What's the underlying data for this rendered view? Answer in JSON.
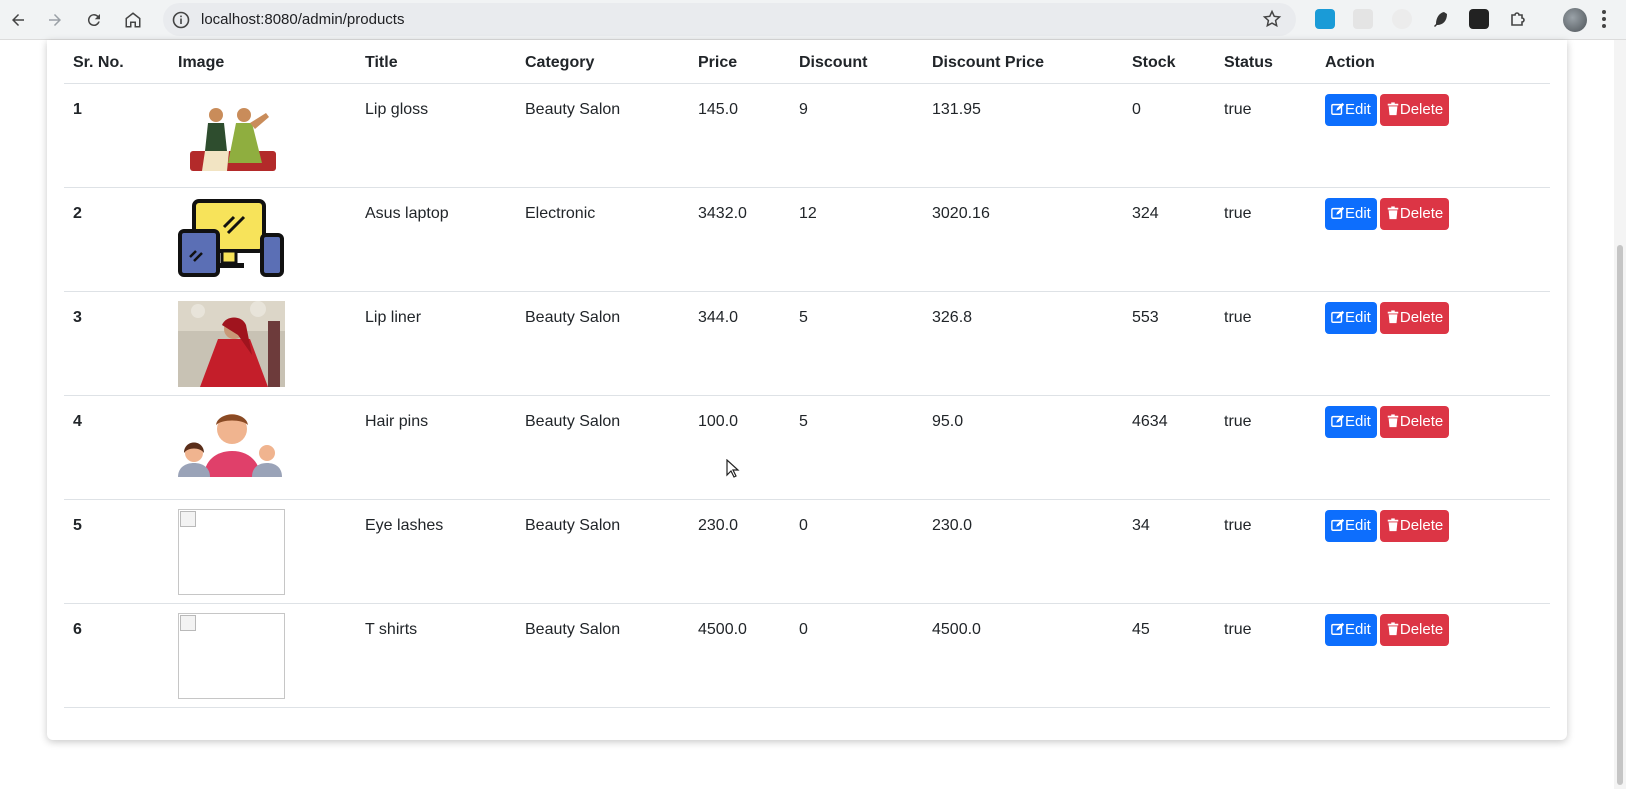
{
  "browser": {
    "url": "localhost:8080/admin/products"
  },
  "table": {
    "headers": [
      "Sr. No.",
      "Image",
      "Title",
      "Category",
      "Price",
      "Discount",
      "Discount Price",
      "Stock",
      "Status",
      "Action"
    ],
    "rows": [
      {
        "sr": "1",
        "image": "couple-illustration",
        "title": "Lip gloss",
        "category": "Beauty Salon",
        "price": "145.0",
        "discount": "9",
        "discount_price": "131.95",
        "stock": "0",
        "status": "true"
      },
      {
        "sr": "2",
        "image": "devices-icon",
        "title": "Asus laptop",
        "category": "Electronic",
        "price": "3432.0",
        "discount": "12",
        "discount_price": "3020.16",
        "stock": "324",
        "status": "true"
      },
      {
        "sr": "3",
        "image": "bride-photo",
        "title": "Lip liner",
        "category": "Beauty Salon",
        "price": "344.0",
        "discount": "5",
        "discount_price": "326.8",
        "stock": "553",
        "status": "true"
      },
      {
        "sr": "4",
        "image": "family-illustration",
        "title": "Hair pins",
        "category": "Beauty Salon",
        "price": "100.0",
        "discount": "5",
        "discount_price": "95.0",
        "stock": "4634",
        "status": "true"
      },
      {
        "sr": "5",
        "image": "broken-image",
        "title": "Eye lashes",
        "category": "Beauty Salon",
        "price": "230.0",
        "discount": "0",
        "discount_price": "230.0",
        "stock": "34",
        "status": "true"
      },
      {
        "sr": "6",
        "image": "broken-image",
        "title": "T shirts",
        "category": "Beauty Salon",
        "price": "4500.0",
        "discount": "0",
        "discount_price": "4500.0",
        "stock": "45",
        "status": "true"
      }
    ],
    "actions": {
      "edit_label": "Edit",
      "delete_label": "Delete"
    }
  },
  "colors": {
    "edit": "#0d6efd",
    "delete": "#dc3545"
  }
}
